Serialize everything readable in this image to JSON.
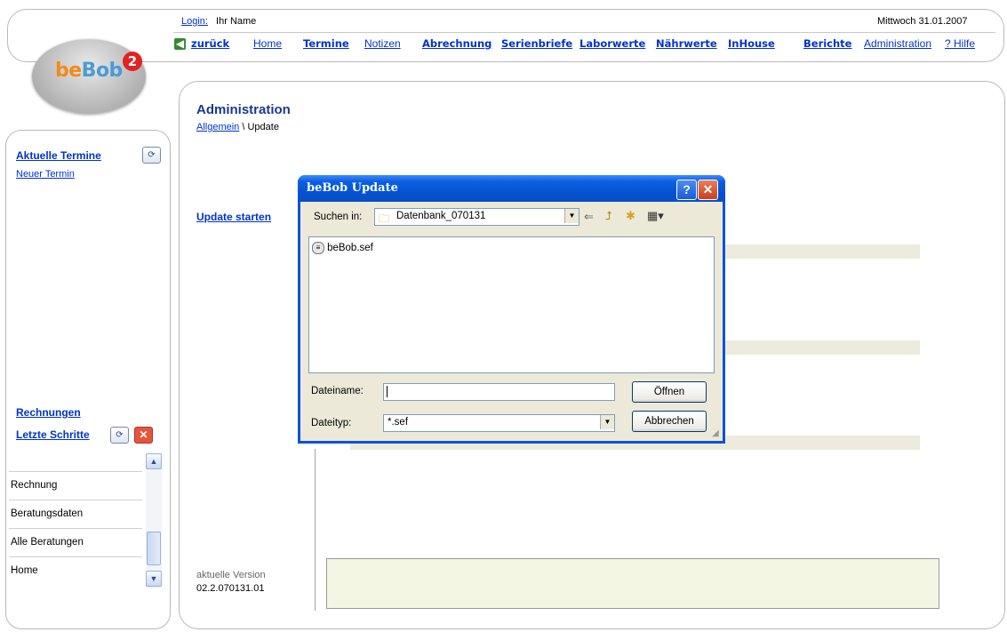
{
  "header": {
    "login_label": "Login:",
    "user_name": "Ihr Name",
    "date": "Mittwoch 31.01.2007",
    "nav": {
      "back": "zurück",
      "home": "Home",
      "termine": "Termine",
      "notizen": "Notizen",
      "abrechnung": "Abrechnung",
      "serienbriefe": "Serienbriefe",
      "laborwerte": "Laborwerte",
      "naehrwerte": "Nährwerte",
      "inhouse": "InHouse",
      "berichte": "Berichte",
      "administration": "Administration",
      "hilfe": "? Hilfe"
    }
  },
  "logo": {
    "part1": "be",
    "part2": "Bob",
    "version": "2"
  },
  "sidebar": {
    "aktuelle_termine": "Aktuelle Termine",
    "neuer_termin": "Neuer Termin",
    "rechnungen": "Rechnungen",
    "letzte_schritte": "Letzte Schritte",
    "steps": [
      "Rechnung",
      "Beratungsdaten",
      "Alle Beratungen",
      "Home"
    ]
  },
  "main": {
    "title": "Administration",
    "breadcrumb_link": "Allgemein",
    "breadcrumb_rest": " \\ Update",
    "update_start": "Update starten",
    "version_label": "aktuelle Version",
    "version_value": "02.2.070131.01"
  },
  "dialog": {
    "title": "beBob Update",
    "help_btn": "?",
    "close_btn": "✕",
    "lookin_label": "Suchen in:",
    "lookin_value": "Datenbank_070131",
    "files": [
      "beBob.sef"
    ],
    "filename_label": "Dateiname:",
    "filename_value": "",
    "filetype_label": "Dateityp:",
    "filetype_value": "*.sef",
    "open_btn": "Öffnen",
    "cancel_btn": "Abbrechen"
  },
  "colors": {
    "link": "#0033cc",
    "dialog_title": "#0551d1",
    "version_box": "#f2f6e3"
  }
}
